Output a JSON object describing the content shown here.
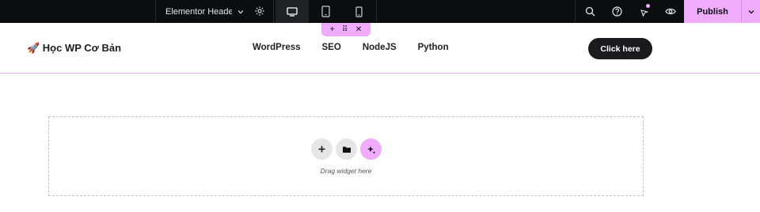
{
  "topbar": {
    "document_title": "Elementor Heade...",
    "devices": [
      "desktop",
      "tablet",
      "mobile"
    ],
    "active_device": "desktop",
    "icons": [
      "search-icon",
      "help-icon",
      "ai-sparkle-icon",
      "preview-eye-icon"
    ],
    "publish_label": "Publish"
  },
  "header": {
    "logo_text": "🚀 Học WP Cơ Bản",
    "nav_items": [
      "WordPress",
      "SEO",
      "NodeJS",
      "Python"
    ],
    "cta_label": "Click here"
  },
  "section_handle": {
    "icons": [
      "add-icon",
      "drag-icon",
      "close-icon"
    ]
  },
  "dropzone": {
    "hint": "Drag widget here",
    "tools": [
      "add-icon",
      "folder-icon",
      "ai-sparkle-icon"
    ]
  },
  "colors": {
    "topbar_bg": "#0c0d0e",
    "accent": "#f0abfc",
    "cta_bg": "#1b1b1e"
  }
}
